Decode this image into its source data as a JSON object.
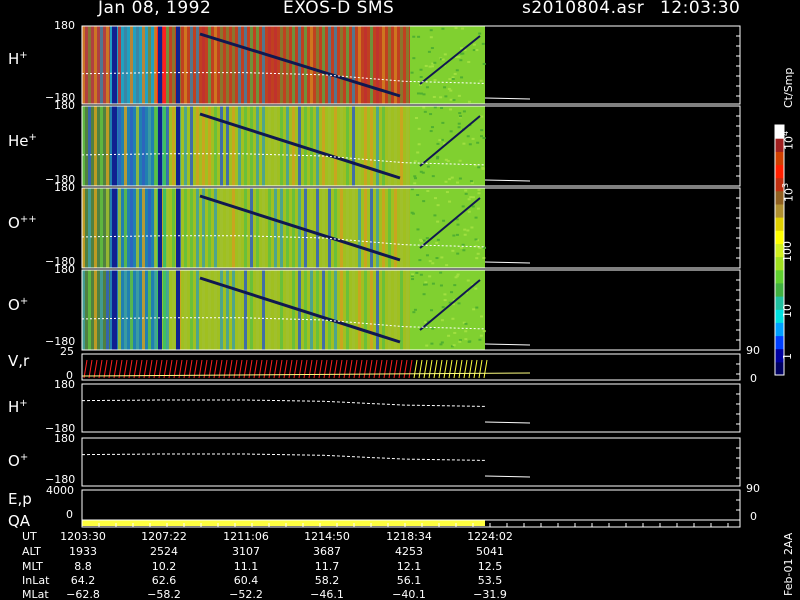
{
  "header": {
    "date": "Jan 08, 1992",
    "instrument": "EXOS-D SMS",
    "file": "s2010804.asr",
    "time": "12:03:30"
  },
  "colorbar": {
    "unit": "Ct/Smp",
    "tick_labels": [
      "1",
      "10",
      "100",
      "10",
      "10"
    ],
    "tick_exponents": [
      "",
      "",
      "",
      "3",
      "4"
    ],
    "colors": [
      "#000060",
      "#0000a0",
      "#0040ff",
      "#00a0ff",
      "#00e0e0",
      "#20c0a0",
      "#40b040",
      "#60d030",
      "#a0e020",
      "#d0f020",
      "#ffff00",
      "#e0d000",
      "#b09030",
      "#906020",
      "#c03010",
      "#ff2000",
      "#d04000",
      "#a02020",
      "#ffffff"
    ]
  },
  "footer": {
    "version": "Feb-01 2AA"
  },
  "chart_data": {
    "type": "heatmap",
    "panels": [
      {
        "id": "h_plus",
        "label": "H",
        "label_sup": "+",
        "ylim": [
          -180,
          180
        ],
        "top_tick": "180",
        "bottom_tick": "−180",
        "kind": "spectrogram"
      },
      {
        "id": "he_plus",
        "label": "He",
        "label_sup": "+",
        "ylim": [
          -180,
          180
        ],
        "top_tick": "180",
        "bottom_tick": "−180",
        "kind": "spectrogram"
      },
      {
        "id": "o_plusplus",
        "label": "O",
        "label_sup": "++",
        "ylim": [
          -180,
          180
        ],
        "top_tick": "180",
        "bottom_tick": "−180",
        "kind": "spectrogram"
      },
      {
        "id": "o_plus",
        "label": "O",
        "label_sup": "+",
        "ylim": [
          -180,
          180
        ],
        "top_tick": "180",
        "bottom_tick": "−180",
        "kind": "spectrogram"
      },
      {
        "id": "v_r",
        "label": "V,r",
        "label_sup": "",
        "ylim": [
          0,
          25
        ],
        "top_tick": "25",
        "bottom_tick": "0",
        "right_ticks": [
          "90",
          "0"
        ],
        "kind": "vectors"
      },
      {
        "id": "h_plus_line",
        "label": "H",
        "label_sup": "+",
        "ylim": [
          -180,
          180
        ],
        "top_tick": "180",
        "bottom_tick": "−180",
        "kind": "line"
      },
      {
        "id": "o_plus_line",
        "label": "O",
        "label_sup": "+",
        "ylim": [
          -180,
          180
        ],
        "top_tick": "180",
        "bottom_tick": "−180",
        "kind": "line"
      },
      {
        "id": "e_p",
        "label": "E,p",
        "label_sup": "",
        "ylim": [
          0,
          4000
        ],
        "top_tick": "4000",
        "bottom_tick": "0",
        "right_ticks": [
          "90",
          "0"
        ],
        "kind": "empty"
      },
      {
        "id": "qa",
        "label": "QA",
        "label_sup": "",
        "kind": "bar"
      }
    ],
    "ephemeris": {
      "rows": [
        {
          "label": "UT",
          "values": [
            "1203:30",
            "1207:22",
            "1211:06",
            "1214:50",
            "1218:34",
            "1224:02"
          ]
        },
        {
          "label": "ALT",
          "values": [
            "1933",
            "2524",
            "3107",
            "3687",
            "4253",
            "5041"
          ]
        },
        {
          "label": "MLT",
          "values": [
            "8.8",
            "10.2",
            "11.1",
            "11.7",
            "12.1",
            "12.5"
          ]
        },
        {
          "label": "InLat",
          "values": [
            "64.2",
            "62.6",
            "60.4",
            "58.2",
            "56.1",
            "53.5"
          ]
        },
        {
          "label": "MLat",
          "values": [
            "−62.8",
            "−58.2",
            "−52.2",
            "−46.1",
            "−40.1",
            "−31.9"
          ]
        }
      ]
    },
    "reference_line": {
      "x_ut": [
        "1203:30",
        "1207:22",
        "1211:06",
        "1214:50",
        "1218:34",
        "1224:02"
      ],
      "y_deg": [
        -120,
        -115,
        -115,
        -125,
        -155,
        -165
      ]
    }
  }
}
